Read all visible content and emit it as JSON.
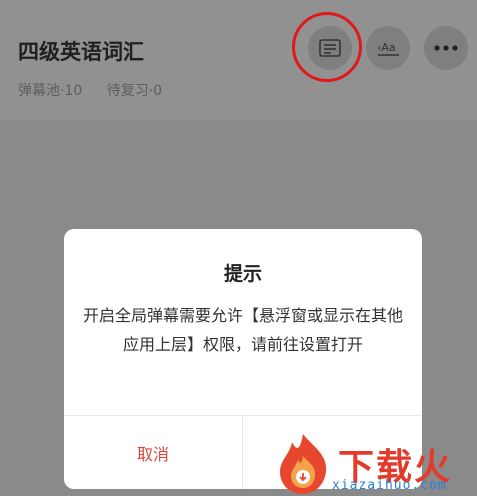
{
  "header": {
    "title": "四级英语词汇",
    "stats": [
      "弹幕池·10",
      "待复习·0"
    ],
    "icons": [
      "danmaku-icon",
      "translate-icon",
      "more-icon"
    ]
  },
  "dialog": {
    "title": "提示",
    "message": "开启全局弹幕需要允许【悬浮窗或显示在其他应用上层】权限，请前往设置打开",
    "cancel_label": "取消"
  },
  "watermark": {
    "text": "下载火",
    "url": "xiazaihuo.com"
  },
  "colors": {
    "accent_red": "#d9463e",
    "annotation_circle": "#e01a1a"
  }
}
